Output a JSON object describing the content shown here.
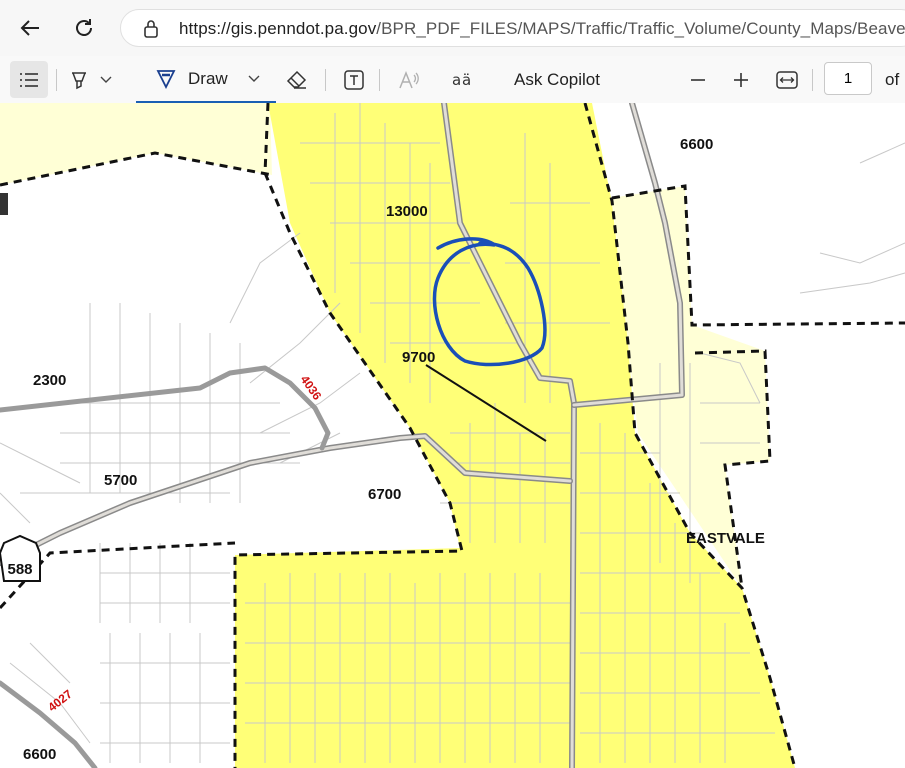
{
  "browser": {
    "url_host": "https://gis.penndot.pa.gov",
    "url_path": "/BPR_PDF_FILES/MAPS/Traffic/Traffic_Volume/County_Maps/Beaver_t"
  },
  "toolbar": {
    "draw_label": "Draw",
    "copilot_label": "Ask Copilot",
    "page_number": "1",
    "page_of": "of"
  },
  "map": {
    "labels": {
      "v13000": "13000",
      "v9700": "9700",
      "v6600_top": "6600",
      "v2300": "2300",
      "v5700": "5700",
      "v6700": "6700",
      "v6600_bottom": "6600",
      "eastvale": "EASTVALE",
      "route_588": "588",
      "route_4036": "4036",
      "route_4027": "4027"
    },
    "colors": {
      "urban_yellow": "#ffff77",
      "light_yellow": "#ffffd6",
      "annotation_blue": "#1a4fb8"
    }
  }
}
